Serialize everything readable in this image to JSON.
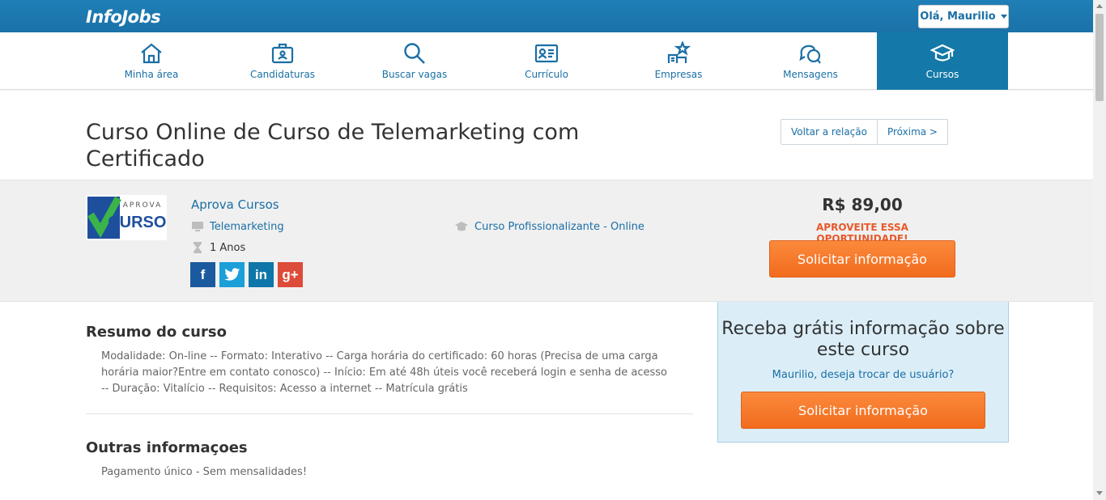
{
  "header": {
    "logo": "InfoJobs",
    "user_greeting": "Olá, Maurilio"
  },
  "nav": [
    {
      "label": "Minha área",
      "icon": "home-icon"
    },
    {
      "label": "Candidaturas",
      "icon": "briefcase-icon"
    },
    {
      "label": "Buscar vagas",
      "icon": "search-icon"
    },
    {
      "label": "Currículo",
      "icon": "id-card-icon"
    },
    {
      "label": "Empresas",
      "icon": "building-star-icon"
    },
    {
      "label": "Mensagens",
      "icon": "chat-bubbles-icon"
    },
    {
      "label": "Cursos",
      "icon": "graduation-cap-icon",
      "active": true
    }
  ],
  "course": {
    "title": "Curso Online de Curso de Telemarketing com Certificado",
    "back_label": "Voltar a relação",
    "next_label": "Próxima >",
    "school_logo_text_top": "APROVA",
    "school_logo_text_bottom": "CURSOS",
    "school_name": "Aprova Cursos",
    "category": "Telemarketing",
    "duration": "1 Anos",
    "type": "Curso Profissionalizante",
    "type_separator": " - ",
    "modality": "Online",
    "price": "R$ 89,00",
    "promo": "APROVEITE ESSA OPORTUNIDADE!",
    "cta_label": "Solicitar informação",
    "share": {
      "facebook": "f",
      "twitter": "t",
      "linkedin": "in",
      "googleplus": "g+"
    }
  },
  "summary": {
    "heading": "Resumo do curso",
    "text": "Modalidade: On-line -- Formato: Interativo -- Carga horária do certificado: 60 horas (Precisa de uma carga horária maior?Entre em contato conosco) -- Início: Em até 48h úteis você receberá login e senha de acesso -- Duração: Vitalício -- Requisitos: Acesso a internet -- Matrícula grátis"
  },
  "other_info": {
    "heading": "Outras informaçoes",
    "text": "Pagamento único - Sem mensalidades!"
  },
  "sidebar": {
    "heading": "Receba grátis informação sobre este curso",
    "change_user": "Maurilio, deseja trocar de usuário?",
    "cta_label": "Solicitar informação"
  },
  "colors": {
    "brand_blue": "#1a72a8",
    "link_blue": "#1a6fa5",
    "cta_orange": "#f47a2c",
    "promo_orange": "#e8592a",
    "active_tab": "#1479a8"
  }
}
